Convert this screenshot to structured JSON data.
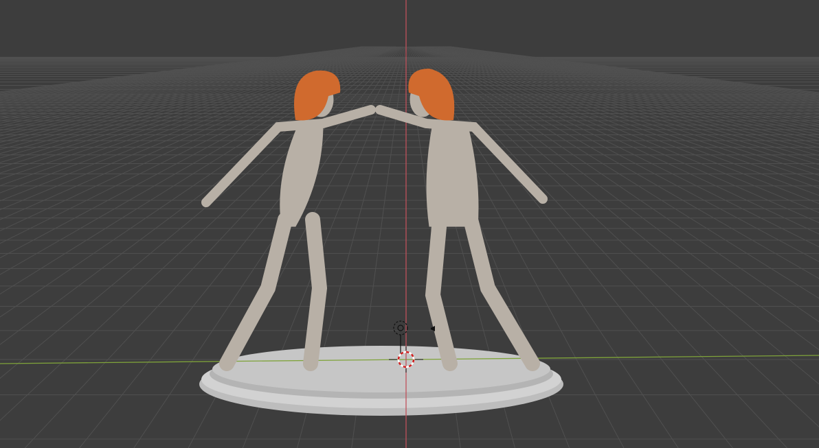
{
  "viewport": {
    "background": "#3d3d3d",
    "grid_color": "#505050",
    "x_axis_color": "#7fa33a",
    "z_axis_color": "#c0505a",
    "pedestal_color": "#c8c8c8",
    "figure_color": "#b8b0a6",
    "hair_color": "#d06a2e"
  },
  "scene_objects": [
    {
      "name": "figure-left"
    },
    {
      "name": "figure-right"
    },
    {
      "name": "pedestal"
    }
  ],
  "overlays": {
    "cursor_icon": "3d-cursor-icon",
    "light_icon": "light-icon",
    "camera_icon": "speaker-icon"
  }
}
